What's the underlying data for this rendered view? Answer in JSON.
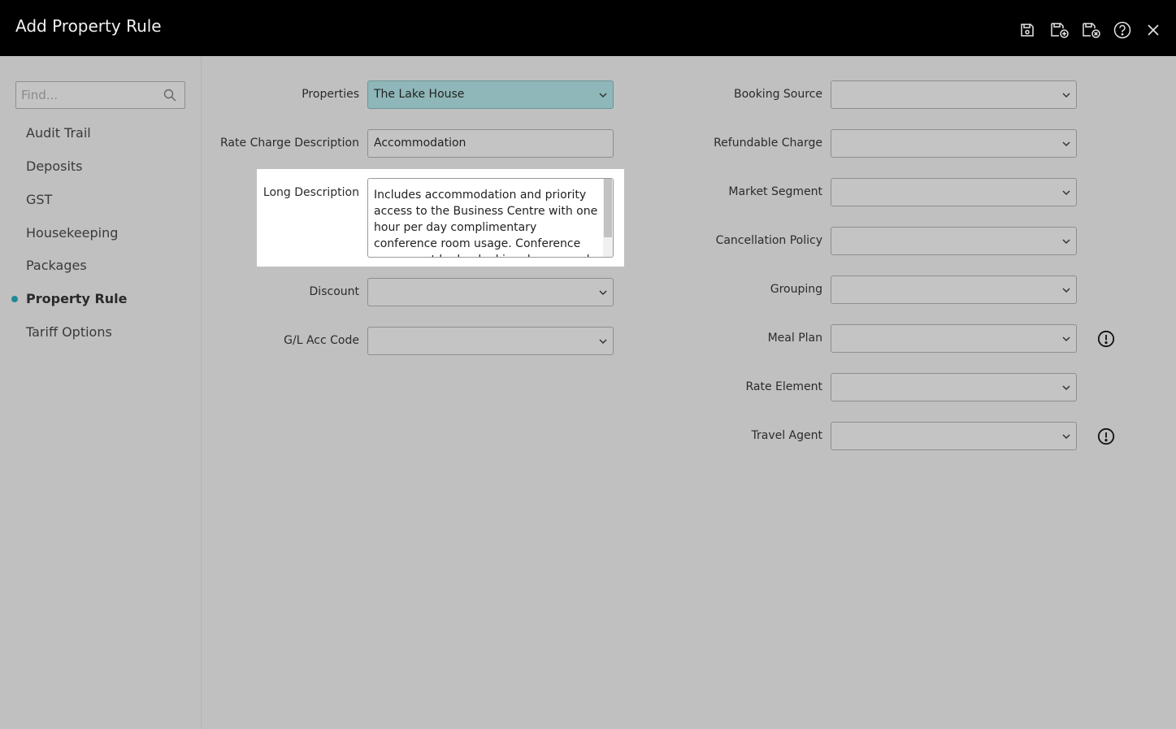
{
  "window": {
    "title": "Add Property Rule"
  },
  "toolbar": [
    "save-icon",
    "save-copy-icon",
    "save-close-icon",
    "help-icon",
    "close-icon"
  ],
  "sidebar": {
    "search_placeholder": "Find...",
    "items": [
      {
        "label": "Audit Trail",
        "active": false
      },
      {
        "label": "Deposits",
        "active": false
      },
      {
        "label": "GST",
        "active": false
      },
      {
        "label": "Housekeeping",
        "active": false
      },
      {
        "label": "Packages",
        "active": false
      },
      {
        "label": "Property Rule",
        "active": true
      },
      {
        "label": "Tariff Options",
        "active": false
      }
    ]
  },
  "form": {
    "left": {
      "properties": {
        "label": "Properties",
        "value": "The Lake House"
      },
      "rate_charge_description": {
        "label": "Rate Charge Description",
        "value": "Accommodation"
      },
      "long_description": {
        "label": "Long Description",
        "value": "Includes accommodation and priority access to the Business Centre with one hour per day complimentary conference room usage. Conference room must be booked in advance and is subject to availability."
      },
      "discount": {
        "label": "Discount",
        "value": ""
      },
      "gl_acc_code": {
        "label": "G/L Acc Code",
        "value": ""
      }
    },
    "right": {
      "booking_source": {
        "label": "Booking Source",
        "value": ""
      },
      "refundable_charge": {
        "label": "Refundable Charge",
        "value": ""
      },
      "market_segment": {
        "label": "Market Segment",
        "value": ""
      },
      "cancellation_policy": {
        "label": "Cancellation Policy",
        "value": ""
      },
      "grouping": {
        "label": "Grouping",
        "value": ""
      },
      "meal_plan": {
        "label": "Meal Plan",
        "value": ""
      },
      "rate_element": {
        "label": "Rate Element",
        "value": ""
      },
      "travel_agent": {
        "label": "Travel Agent",
        "value": ""
      }
    }
  },
  "colors": {
    "accent": "#1e8a94",
    "selected_field": "#8fb7b9",
    "titlebar": "#000000",
    "background": "#c0c0c0"
  }
}
